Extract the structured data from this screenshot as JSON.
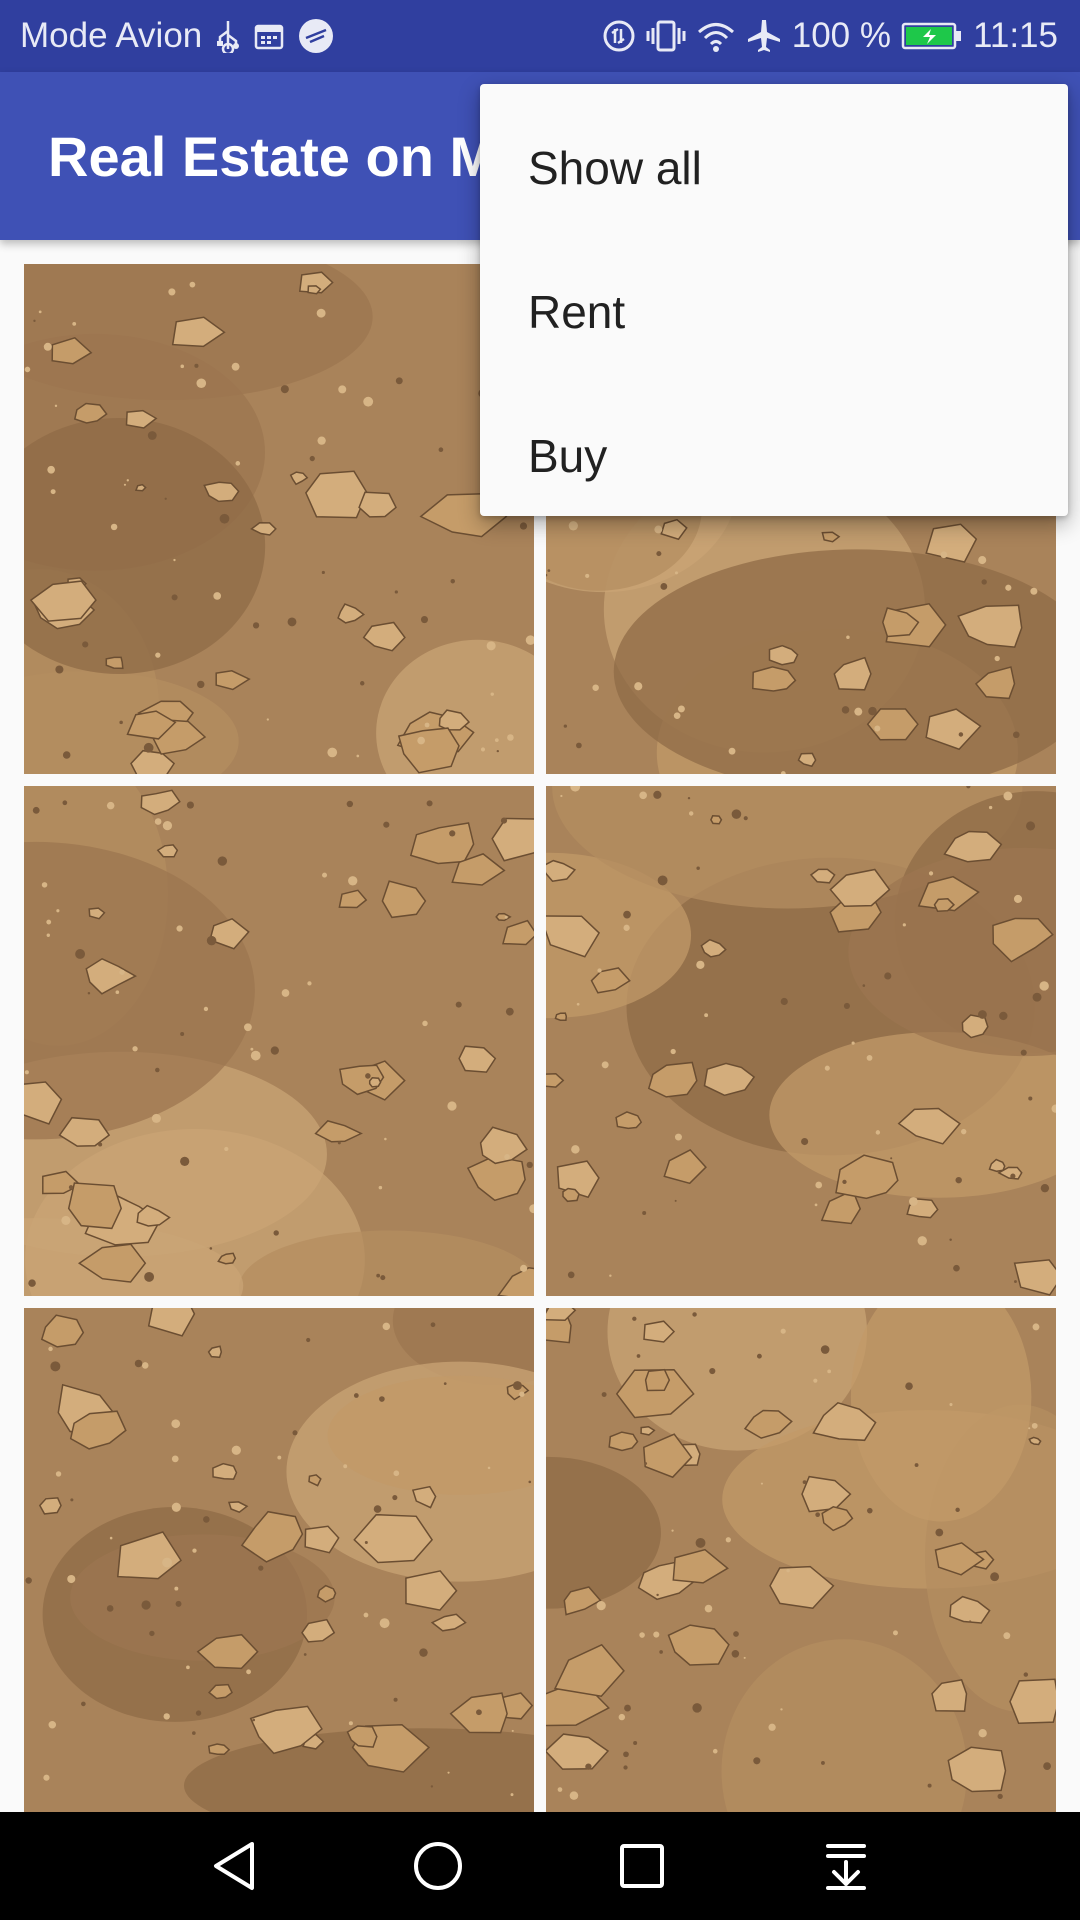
{
  "status_bar": {
    "carrier_text": "Mode Avion",
    "battery_text": "100 %",
    "time": "11:15",
    "icons": [
      "usb-icon",
      "calendar-icon",
      "app-notification-icon",
      "data-saver-icon",
      "vibrate-icon",
      "wifi-icon",
      "airplane-icon",
      "battery-charging-icon"
    ]
  },
  "app_bar": {
    "title": "Real Estate on Mars"
  },
  "overflow_menu": {
    "items": [
      {
        "label": "Show all"
      },
      {
        "label": "Rent"
      },
      {
        "label": "Buy"
      }
    ]
  },
  "grid": {
    "columns": 2,
    "tiles": [
      {
        "name": "mars-photo-1"
      },
      {
        "name": "mars-photo-2"
      },
      {
        "name": "mars-photo-3"
      },
      {
        "name": "mars-photo-4"
      },
      {
        "name": "mars-photo-5"
      },
      {
        "name": "mars-photo-6"
      }
    ]
  },
  "nav_bar": {
    "buttons": [
      "back-icon",
      "home-icon",
      "recents-icon",
      "notification-pulldown-icon"
    ]
  },
  "colors": {
    "status_bar": "#303f9f",
    "app_bar": "#3f51b5",
    "menu_background": "#fafafa",
    "mars_sand": "#b98f5d"
  }
}
